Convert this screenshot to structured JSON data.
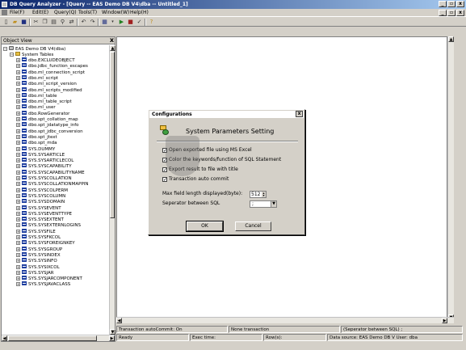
{
  "window": {
    "title": "DB Query Analyzer - [Query -- EAS Demo DB V4\\dba -- Untitled_1]",
    "min": "_",
    "max": "▫",
    "close": "x"
  },
  "menu": [
    "File(F)",
    "Edit(E)",
    "Query(Q)",
    "Tools(T)",
    "Window(W)",
    "Help(H)"
  ],
  "mdi": {
    "min": "_",
    "max": "▫",
    "close": "x"
  },
  "toolbar": {
    "icons": [
      "new-file-icon",
      "open-folder-icon",
      "save-icon",
      "cut-icon",
      "copy-icon",
      "paste-icon",
      "find-icon",
      "replace-icon",
      "undo-icon",
      "redo-icon",
      "results-grid-icon",
      "dropdown-icon",
      "execute-icon",
      "stop-icon",
      "parse-icon",
      "help-icon"
    ]
  },
  "object_view": {
    "title": "Object View",
    "close": "x",
    "root": "EAS Demo DB V4(dba)",
    "folder": "System Tables",
    "tables": [
      "dbo.EXCLUDEOBJECT",
      "dbo.jdbc_function_escapes",
      "dbo.ml_connection_script",
      "dbo.ml_script",
      "dbo.ml_script_version",
      "dbo.ml_scripts_modified",
      "dbo.ml_table",
      "dbo.ml_table_script",
      "dbo.ml_user",
      "dbo.RowGenerator",
      "dbo.spt_collation_map",
      "dbo.spt_jdatatype_info",
      "dbo.spt_jdbc_conversion",
      "dbo.spt_jtext",
      "dbo.spt_mda",
      "SYS.DUMMY",
      "SYS.SYSARTICLE",
      "SYS.SYSARTICLECOL",
      "SYS.SYSCAPABILITY",
      "SYS.SYSCAPABILITYNAME",
      "SYS.SYSCOLLATION",
      "SYS.SYSCOLLATIONMAPPIN",
      "SYS.SYSCOLPERM",
      "SYS.SYSCOLUMN",
      "SYS.SYSDOMAIN",
      "SYS.SYSEVENT",
      "SYS.SYSEVENTTYPE",
      "SYS.SYSEXTENT",
      "SYS.SYSEXTERNLOGINS",
      "SYS.SYSFILE",
      "SYS.SYSFKCOL",
      "SYS.SYSFOREIGNKEY",
      "SYS.SYSGROUP",
      "SYS.SYSINDEX",
      "SYS.SYSINFO",
      "SYS.SYSIXCOL",
      "SYS.SYSJAR",
      "SYS.SYSJARCOMPONENT",
      "SYS.SYSJAVACLASS"
    ]
  },
  "dialog": {
    "title": "Configurations",
    "close": "x",
    "heading": "System Parameters Setting",
    "options": [
      {
        "label": "Open exported file using MS Excel",
        "checked": true
      },
      {
        "label": "Color the keywords/function of SQL Statement",
        "checked": true
      },
      {
        "label": "Export result to file with title",
        "checked": true
      },
      {
        "label": "Transaction auto commit",
        "checked": true
      }
    ],
    "max_field_label": "Max field length displayed(byte):",
    "max_field_value": "512",
    "separator_label": "Seperator between SQL",
    "separator_value": ";",
    "ok": "OK",
    "cancel": "Cancel"
  },
  "status": {
    "commit": "Transaction autoCommit: On",
    "transaction": "None transaction",
    "separator": "(Seperator between SQL) ;",
    "ready": "Ready",
    "exec_time": "Exec time:",
    "rows": "Row(s):",
    "datasource": "Data source: EAS Demo DB V User: dba"
  }
}
